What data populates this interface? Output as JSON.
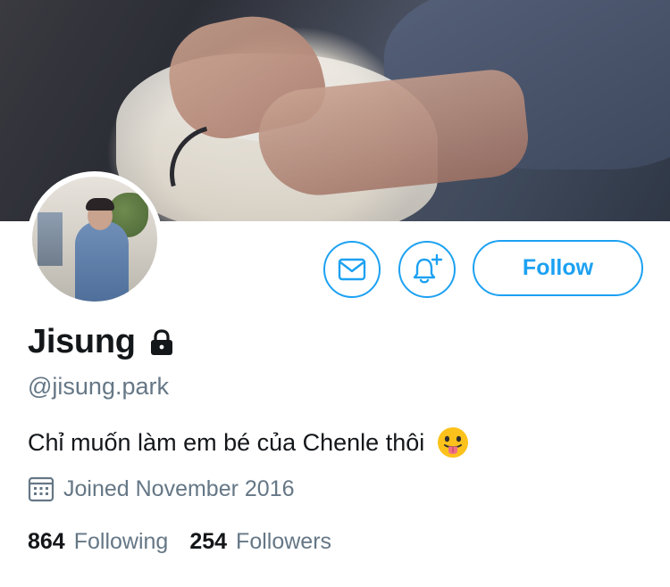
{
  "profile": {
    "display_name": "Jisung",
    "handle": "@jisung.park",
    "bio": "Chỉ muốn làm em bé của Chenle thôi",
    "bio_emoji": "face-with-tongue-icon",
    "joined": "Joined November 2016",
    "protected_icon": "lock-icon"
  },
  "actions": {
    "message_icon": "envelope-icon",
    "notify_icon": "bell-plus-icon",
    "follow_label": "Follow"
  },
  "stats": [
    {
      "count": "864",
      "label": "Following"
    },
    {
      "count": "254",
      "label": "Followers"
    }
  ],
  "colors": {
    "accent": "#1da1f2",
    "text": "#14171a",
    "secondary": "#657786"
  }
}
